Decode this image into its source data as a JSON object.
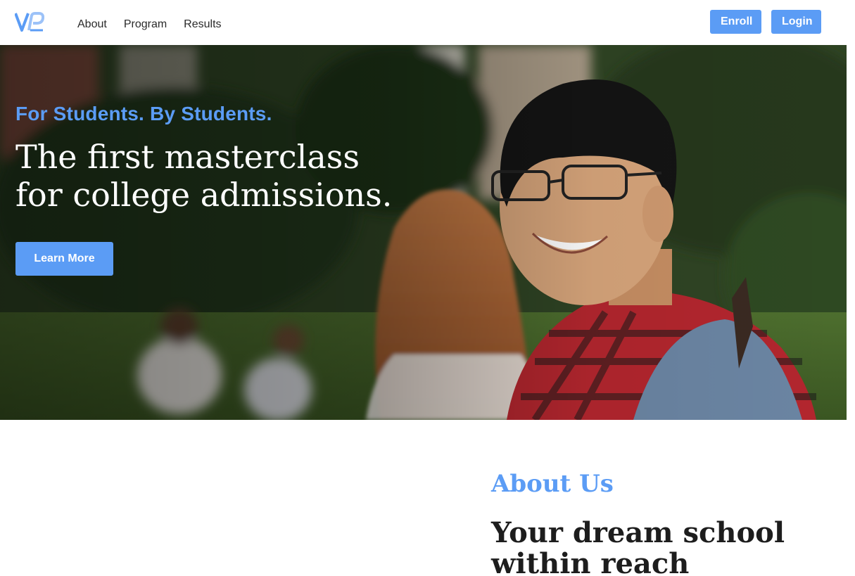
{
  "brand": {
    "logo_icon": "vp-logo-icon",
    "accent_color": "#5b9cf5"
  },
  "nav": {
    "links": [
      {
        "label": "About"
      },
      {
        "label": "Program"
      },
      {
        "label": "Results"
      }
    ],
    "enroll_label": "Enroll",
    "login_label": "Login"
  },
  "hero": {
    "tagline": "For Students. By Students.",
    "title_line1": "The first masterclass",
    "title_line2": "for college admissions.",
    "cta_label": "Learn More",
    "image": "students-campus-photo"
  },
  "about": {
    "eyebrow": "About Us",
    "heading": "Your dream school within reach"
  }
}
